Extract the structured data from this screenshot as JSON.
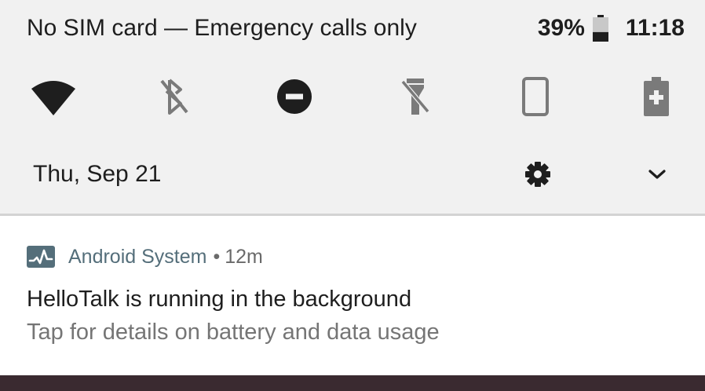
{
  "status_bar": {
    "carrier_text": "No SIM card — Emergency calls only",
    "battery_percent": "39%",
    "battery_level": 0.39,
    "time": "11:18"
  },
  "quick_settings": {
    "tiles": [
      {
        "icon": "wifi-icon",
        "state": "on"
      },
      {
        "icon": "bluetooth-off-icon",
        "state": "off"
      },
      {
        "icon": "do-not-disturb-icon",
        "state": "on"
      },
      {
        "icon": "flashlight-off-icon",
        "state": "off"
      },
      {
        "icon": "auto-rotate-off-icon",
        "state": "off"
      },
      {
        "icon": "battery-saver-icon",
        "state": "off"
      }
    ]
  },
  "header": {
    "date": "Thu, Sep 21",
    "settings_icon": "gear-icon",
    "expand_icon": "chevron-down-icon"
  },
  "notification": {
    "app_icon": "pulse-chart-icon",
    "app_name": "Android System",
    "separator": "•",
    "time": "12m",
    "title": "HelloTalk is running in the background",
    "text": "Tap for details on battery and data usage"
  },
  "colors": {
    "shade_background": "#f1f1f1",
    "notification_background": "#ffffff",
    "app_accent": "#546e7a",
    "icon_active": "#1e1e1e",
    "icon_inactive": "#7a7a7a",
    "wallpaper": "#3a2a30"
  }
}
